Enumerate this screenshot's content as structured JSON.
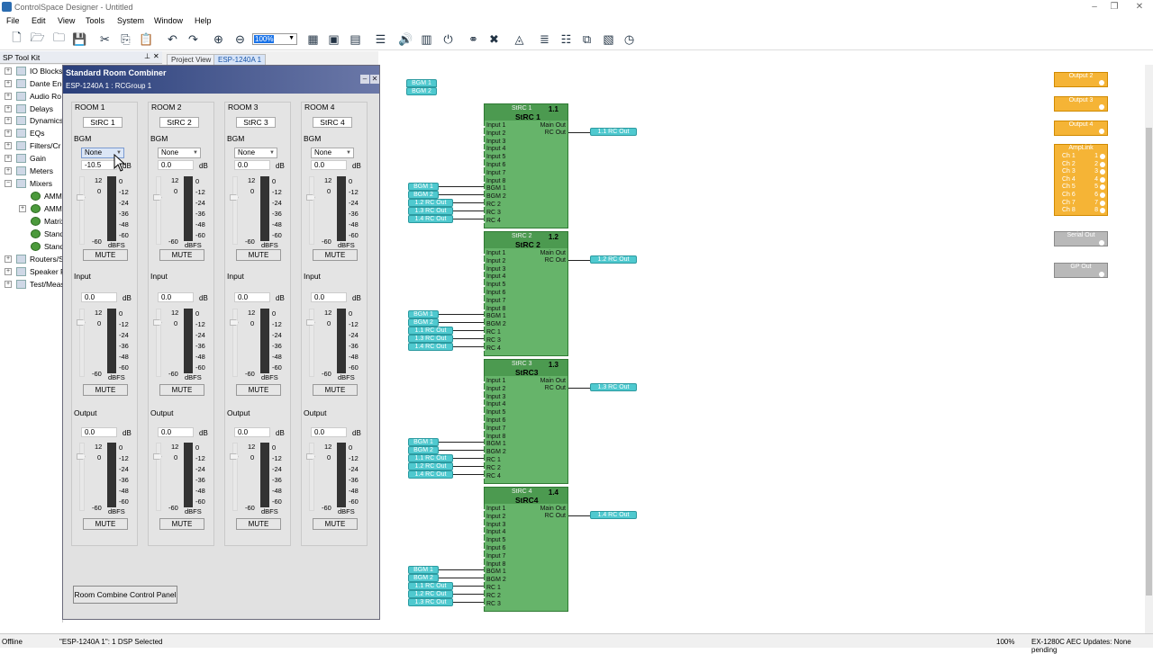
{
  "app": {
    "title": "ControlSpace Designer - Untitled"
  },
  "menu": [
    "File",
    "Edit",
    "View",
    "Tools",
    "System",
    "Window",
    "Help"
  ],
  "toolbar": {
    "zoom": "100%"
  },
  "panel": {
    "title": "SP Tool Kit"
  },
  "tabs": [
    {
      "label": "Project View"
    },
    {
      "label": "ESP-1240A 1"
    }
  ],
  "tree": [
    {
      "label": "IO Blocks"
    },
    {
      "label": "Dante Enc"
    },
    {
      "label": "Audio Ro"
    },
    {
      "label": "Delays"
    },
    {
      "label": "Dynamics"
    },
    {
      "label": "EQs"
    },
    {
      "label": "Filters/Cr"
    },
    {
      "label": "Gain"
    },
    {
      "label": "Meters"
    },
    {
      "label": "Mixers"
    },
    {
      "label": "AMM"
    },
    {
      "label": "AMM"
    },
    {
      "label": "Matrix"
    },
    {
      "label": "Stand"
    },
    {
      "label": "Stand"
    },
    {
      "label": "Routers/S"
    },
    {
      "label": "Speaker P"
    },
    {
      "label": "Test/Meas"
    }
  ],
  "dialog": {
    "title": "Standard Room Combiner",
    "subtitle": "ESP-1240A 1 : RCGroup 1",
    "bgm_label": "BGM",
    "input_label": "Input",
    "output_label": "Output",
    "db": "dB",
    "dbfs": "dBFS",
    "mute": "MUTE",
    "scale": {
      "top": "12",
      "zero": "0",
      "bottom": "-60",
      "marks": [
        "0",
        "-12",
        "-24",
        "-36",
        "-48",
        "-60"
      ]
    },
    "rooms": [
      {
        "header": "ROOM 1",
        "name": "StRC 1",
        "bgm_select": "None",
        "bgm_gain": "-10.5",
        "input_gain": "0.0",
        "output_gain": "0.0"
      },
      {
        "header": "ROOM 2",
        "name": "StRC 2",
        "bgm_select": "None",
        "bgm_gain": "0.0",
        "input_gain": "0.0",
        "output_gain": "0.0"
      },
      {
        "header": "ROOM 3",
        "name": "StRC 3",
        "bgm_select": "None",
        "bgm_gain": "0.0",
        "input_gain": "0.0",
        "output_gain": "0.0"
      },
      {
        "header": "ROOM 4",
        "name": "StRC 4",
        "bgm_select": "None",
        "bgm_gain": "0.0",
        "input_gain": "0.0",
        "output_gain": "0.0"
      }
    ],
    "control_panel_button": "Room Combine Control Panel"
  },
  "canvas": {
    "top_tags": [
      "BGM 1",
      "BGM 2"
    ],
    "blocks": [
      {
        "index": "StRC 1",
        "num": "1.1",
        "name": "StRC 1",
        "out": "1.1 RC Out",
        "rc_tags": [
          "1.2 RC Out",
          "1.3 RC Out",
          "1.4 RC Out"
        ],
        "rc_pins": [
          "RC 2",
          "RC 3",
          "RC 4"
        ]
      },
      {
        "index": "StRC 2",
        "num": "1.2",
        "name": "StRC 2",
        "out": "1.2 RC Out",
        "rc_tags": [
          "1.1 RC Out",
          "1.3 RC Out",
          "1.4 RC Out"
        ],
        "rc_pins": [
          "RC 1",
          "RC 3",
          "RC 4"
        ]
      },
      {
        "index": "StRC 3",
        "num": "1.3",
        "name": "StRC3",
        "out": "1.3 RC Out",
        "rc_tags": [
          "1.1 RC Out",
          "1.2 RC Out",
          "1.4 RC Out"
        ],
        "rc_pins": [
          "RC 1",
          "RC 2",
          "RC 4"
        ]
      },
      {
        "index": "StRC 4",
        "num": "1.4",
        "name": "StRC4",
        "out": "1.4 RC Out",
        "rc_tags": [
          "1.1 RC Out",
          "1.2 RC Out",
          "1.3 RC Out"
        ],
        "rc_pins": [
          "RC 1",
          "RC 2",
          "RC 3"
        ]
      }
    ],
    "input_pins": [
      "Input 1",
      "Input 2",
      "Input 3",
      "Input 4",
      "Input 5",
      "Input 6",
      "Input 7",
      "Input 8",
      "BGM 1",
      "BGM 2"
    ],
    "out_pins": [
      "Main Out",
      "RC Out"
    ],
    "bgm_tags": [
      "BGM 1",
      "BGM 2"
    ],
    "outputs": [
      "Output 2",
      "Output 3",
      "Output 4"
    ],
    "amplink": {
      "title": "AmpLink",
      "channels": [
        "Ch 1",
        "Ch 2",
        "Ch 3",
        "Ch 4",
        "Ch 5",
        "Ch 6",
        "Ch 7",
        "Ch 8"
      ],
      "nums": [
        "1",
        "2",
        "3",
        "4",
        "5",
        "6",
        "7",
        "8"
      ]
    },
    "serial_out": "Serial Out",
    "gp_out": "GP Out"
  },
  "status": {
    "left": "Offline",
    "center": "\"ESP-1240A 1\": 1 DSP Selected",
    "zoom": "100%",
    "right": "EX-1280C AEC Updates: None pending"
  }
}
